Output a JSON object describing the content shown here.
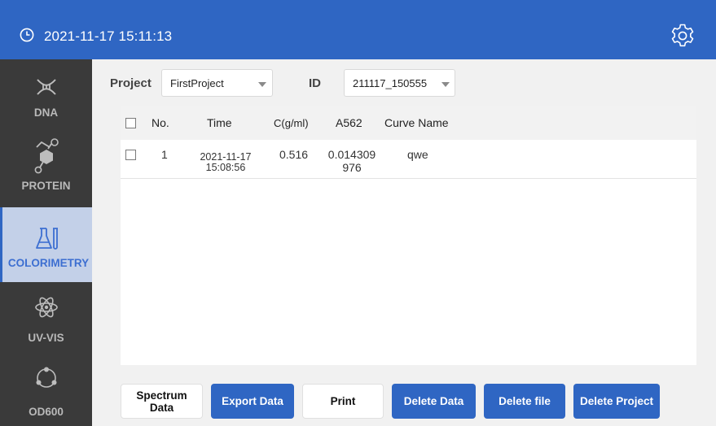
{
  "header": {
    "datetime": "2021-11-17 15:11:13"
  },
  "sidebar": {
    "items": [
      {
        "label": "DNA",
        "icon": "dna-icon",
        "active": false
      },
      {
        "label": "PROTEIN",
        "icon": "protein-icon",
        "active": false
      },
      {
        "label": "COLORIMETRY",
        "icon": "flask-icon",
        "active": true
      },
      {
        "label": "UV-VIS",
        "icon": "atom-icon",
        "active": false
      },
      {
        "label": "OD600",
        "icon": "cells-icon",
        "active": false
      }
    ]
  },
  "filters": {
    "project_label": "Project",
    "project_value": "FirstProject",
    "id_label": "ID",
    "id_value": "211117_150555"
  },
  "table": {
    "columns": [
      "No.",
      "Time",
      "C(g/ml)",
      "A562",
      "Curve Name"
    ],
    "rows": [
      {
        "no": "1",
        "time_date": "2021-11-17",
        "time_clock": "15:08:56",
        "conc": "0.516",
        "a562_line1": "0.014309",
        "a562_line2": "976",
        "curve": "qwe"
      }
    ]
  },
  "buttons": {
    "spectrum_line1": "Spectrum",
    "spectrum_line2": "Data",
    "export": "Export Data",
    "print": "Print",
    "delete_data": "Delete Data",
    "delete_file": "Delete file",
    "delete_project": "Delete Project"
  },
  "colors": {
    "accent": "#2f66c3",
    "sidebar": "#3a3a3a",
    "active_bg": "#c3d0e8"
  }
}
